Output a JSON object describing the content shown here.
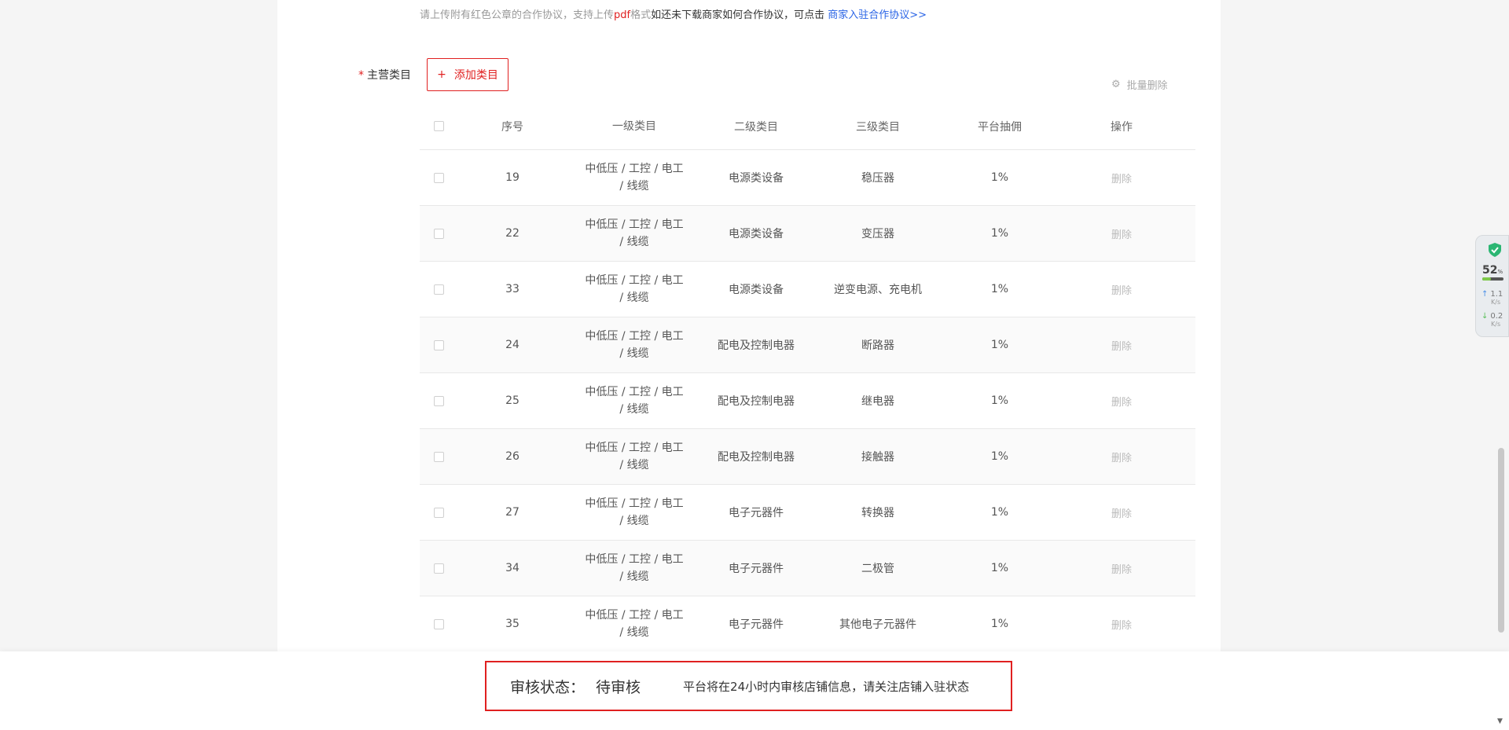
{
  "upload_hint": {
    "text1": "请上传附有红色公章的合作协议，支持上传",
    "pdf": "pdf",
    "text2": "格式",
    "text3": "如还未下载商家如何合作协议，可点击 ",
    "link": "商家入驻合作协议>>"
  },
  "category": {
    "required_mark": "*",
    "label": "主营类目",
    "add_button": {
      "icon": "+",
      "label": "添加类目"
    },
    "bulk_delete": {
      "icon": "gear-icon",
      "label": "批量删除"
    }
  },
  "table": {
    "headers": [
      "序号",
      "一级类目",
      "二级类目",
      "三级类目",
      "平台抽佣",
      "操作"
    ],
    "rows": [
      {
        "idx": "19",
        "l1a": "中低压 / 工控 / 电工",
        "l1b": "/ 线缆",
        "l2": "电源类设备",
        "l3": "稳压器",
        "fee": "1%",
        "op": "删除"
      },
      {
        "idx": "22",
        "l1a": "中低压 / 工控 / 电工",
        "l1b": "/ 线缆",
        "l2": "电源类设备",
        "l3": "变压器",
        "fee": "1%",
        "op": "删除"
      },
      {
        "idx": "33",
        "l1a": "中低压 / 工控 / 电工",
        "l1b": "/ 线缆",
        "l2": "电源类设备",
        "l3": "逆变电源、充电机",
        "fee": "1%",
        "op": "删除"
      },
      {
        "idx": "24",
        "l1a": "中低压 / 工控 / 电工",
        "l1b": "/ 线缆",
        "l2": "配电及控制电器",
        "l3": "断路器",
        "fee": "1%",
        "op": "删除"
      },
      {
        "idx": "25",
        "l1a": "中低压 / 工控 / 电工",
        "l1b": "/ 线缆",
        "l2": "配电及控制电器",
        "l3": "继电器",
        "fee": "1%",
        "op": "删除"
      },
      {
        "idx": "26",
        "l1a": "中低压 / 工控 / 电工",
        "l1b": "/ 线缆",
        "l2": "配电及控制电器",
        "l3": "接触器",
        "fee": "1%",
        "op": "删除"
      },
      {
        "idx": "27",
        "l1a": "中低压 / 工控 / 电工",
        "l1b": "/ 线缆",
        "l2": "电子元器件",
        "l3": "转换器",
        "fee": "1%",
        "op": "删除"
      },
      {
        "idx": "34",
        "l1a": "中低压 / 工控 / 电工",
        "l1b": "/ 线缆",
        "l2": "电子元器件",
        "l3": "二极管",
        "fee": "1%",
        "op": "删除"
      },
      {
        "idx": "35",
        "l1a": "中低压 / 工控 / 电工",
        "l1b": "/ 线缆",
        "l2": "电子元器件",
        "l3": "其他电子元器件",
        "fee": "1%",
        "op": "删除"
      }
    ]
  },
  "footer": {
    "status_label": "审核状态：",
    "status_value": "待审核",
    "note": "平台将在24小时内审核店铺信息，请关注店铺入驻状态"
  },
  "widget": {
    "battery_percent": "52",
    "percent_sign": "%",
    "battery_level": 0.4,
    "upload_speed": "1.1",
    "download_speed": "0.2",
    "speed_unit": "K/s",
    "icon": "shield-check-icon"
  }
}
